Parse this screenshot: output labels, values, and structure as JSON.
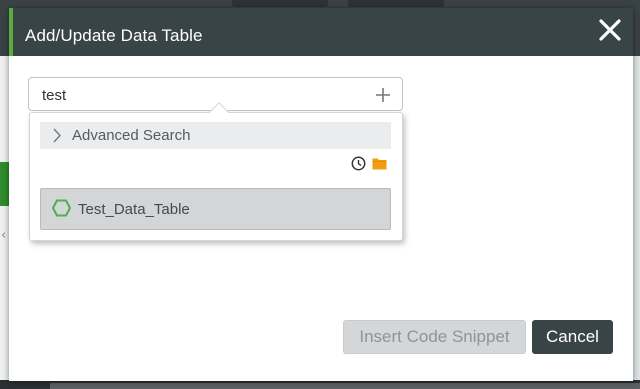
{
  "dialog": {
    "title": "Add/Update Data Table"
  },
  "search": {
    "value": "test",
    "placeholder": ""
  },
  "dropdown": {
    "advanced_search_label": "Advanced Search",
    "results": [
      {
        "label": "Test_Data_Table",
        "icon": "hexagon-icon"
      }
    ]
  },
  "footer": {
    "insert_label": "Insert Code Snippet",
    "cancel_label": "Cancel"
  },
  "colors": {
    "header_bg": "#394447",
    "accent_green": "#5aac3c",
    "folder_orange": "#f39c12",
    "hexagon_green": "#4caf50"
  },
  "icons": [
    "close-icon",
    "add-icon",
    "chevron-right-icon",
    "clock-icon",
    "folder-icon",
    "hexagon-icon"
  ]
}
